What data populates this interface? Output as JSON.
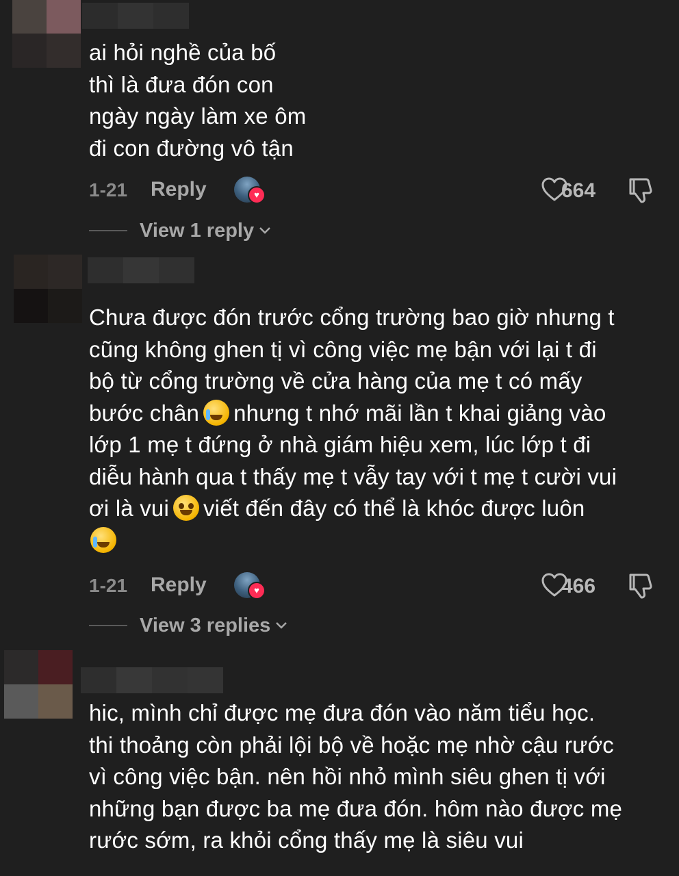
{
  "comments": [
    {
      "text": "ai hỏi nghề của bố\nthì là đưa đón con\nngày ngày làm xe ôm\nđi con đường vô tận",
      "date": "1-21",
      "reply_label": "Reply",
      "likes": "664",
      "view_replies": "View 1 reply"
    },
    {
      "text_parts": [
        "Chưa được đón trước cổng trường bao giờ nhưng t\ncũng không ghen tị vì công việc mẹ bận với lại t đi\nbộ từ cổng trường về cửa hàng của mẹ t có mấy\nbước chân",
        "nhưng t nhớ mãi lần t khai giảng vào\nlớp 1 mẹ t đứng ở nhà giám hiệu xem, lúc lớp t đi\ndiễu hành qua t thấy mẹ t vẫy tay với t mẹ t cười vui\nơi là vui",
        "viết đến đây có thể là khóc được luôn\n"
      ],
      "date": "1-21",
      "reply_label": "Reply",
      "likes": "466",
      "view_replies": "View 3 replies"
    },
    {
      "text": "hic, mình chỉ được mẹ đưa đón vào năm tiểu học.\nthi thoảng còn phải lội bộ về hoặc mẹ nhờ cậu rước\nvì công việc bận. nên hồi nhỏ mình siêu ghen tị với\nnhững bạn được ba mẹ đưa đón. hôm nào được mẹ\nrước sớm, ra khỏi cổng thấy mẹ là siêu vui"
    }
  ],
  "icons": {
    "like": "heart-outline-icon",
    "dislike": "thumbs-down-icon",
    "creator_like": "creator-heart-icon",
    "chevron": "chevron-down-icon"
  },
  "colors": {
    "background": "#1f1f1f",
    "text": "#ffffff",
    "meta": "#8a8a8a",
    "heart": "#fe2c55"
  }
}
